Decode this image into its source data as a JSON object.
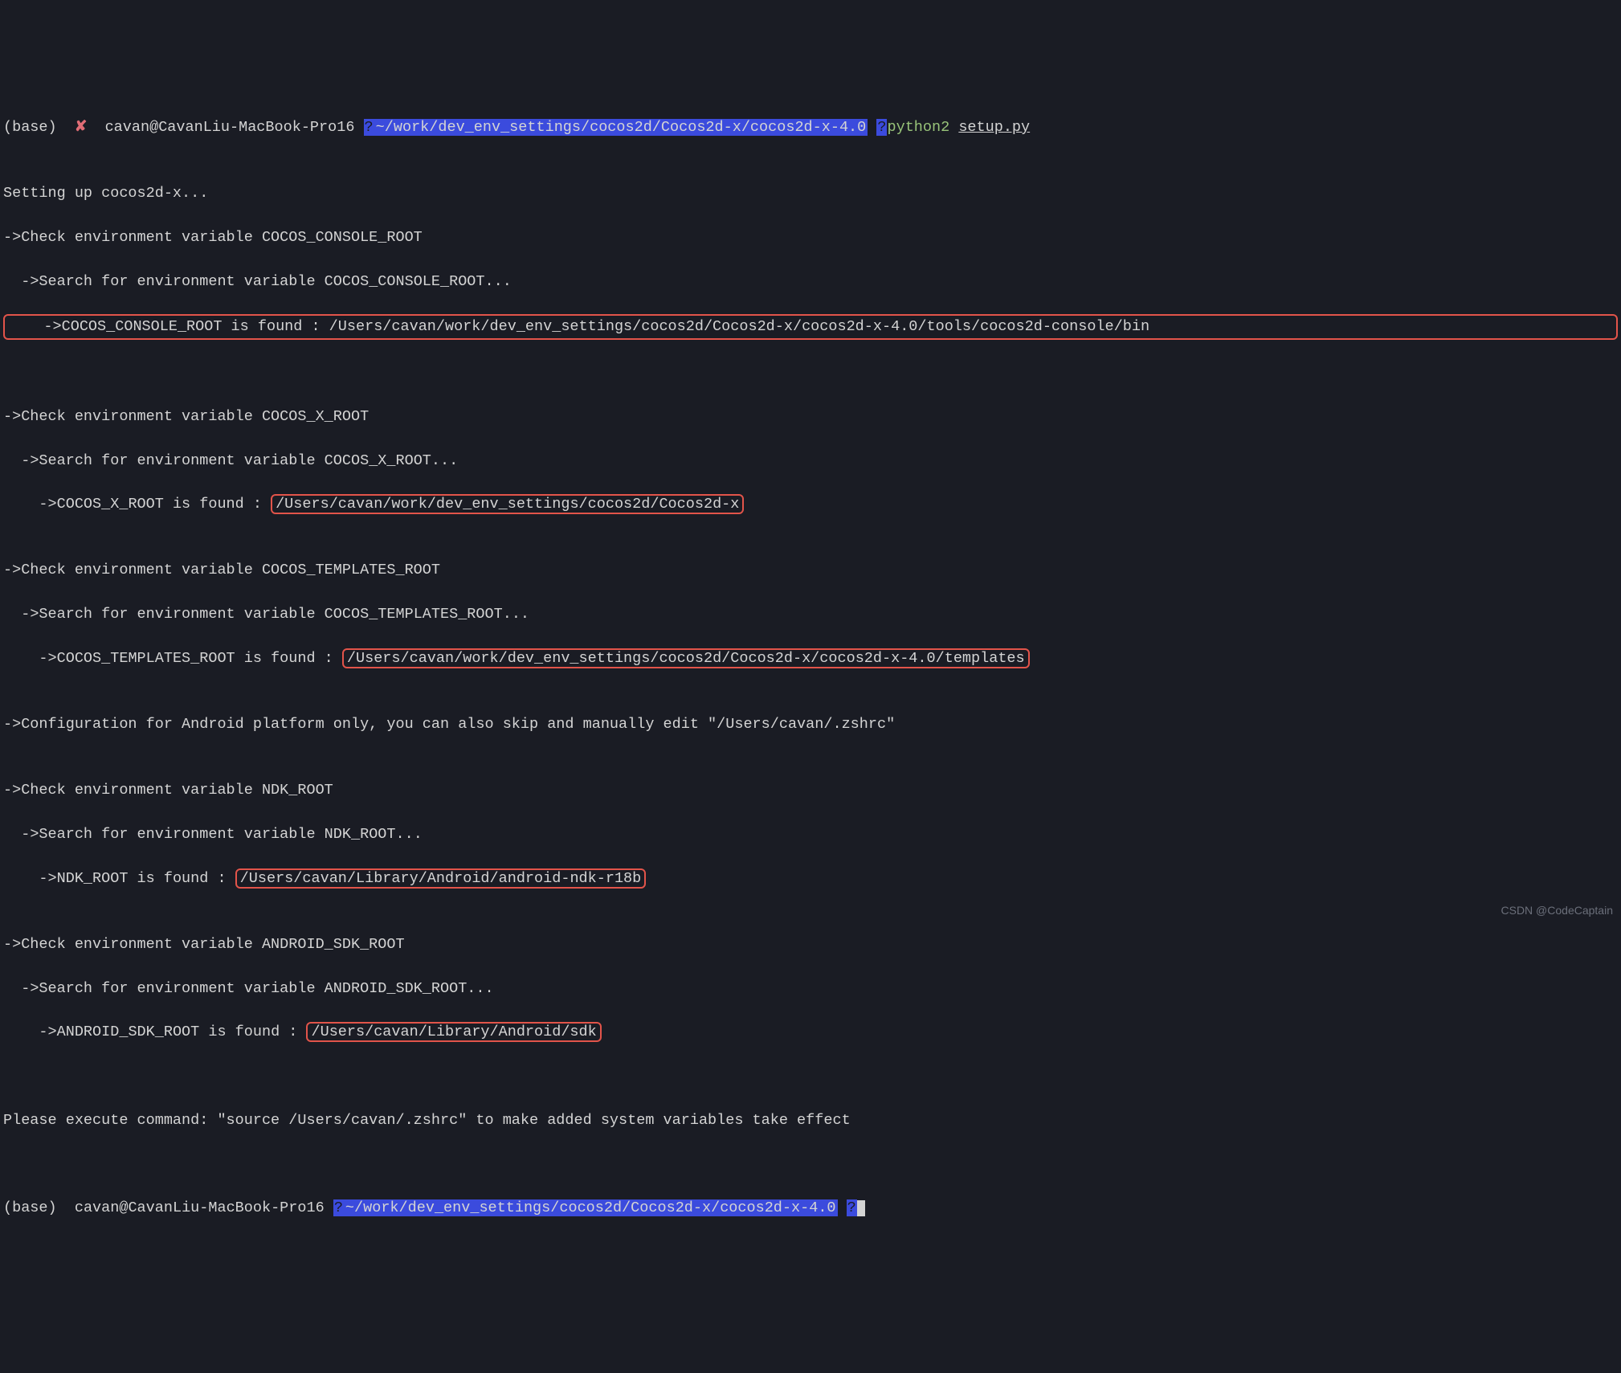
{
  "prompt1": {
    "base": "(base)",
    "x": "✘",
    "user": "cavan@CavanLiu-MacBook-Pro16",
    "q1": "?",
    "path": "~/work/dev_env_settings/cocos2d/Cocos2d-x/cocos2d-x-4.0",
    "q2": "?",
    "python": "python2",
    "cmd": "setup.py"
  },
  "output": {
    "l_blank0": "",
    "l_setup": "Setting up cocos2d-x...",
    "l_ccr_check": "->Check environment variable COCOS_CONSOLE_ROOT",
    "l_ccr_search": "  ->Search for environment variable COCOS_CONSOLE_ROOT...",
    "l_ccr_found_pre": "    ->COCOS_CONSOLE_ROOT is found : /Users/cavan/work/dev_env_settings/cocos2d/Cocos2d-x/cocos2d-x-4.0/tools/cocos2d-console/bin",
    "l_blank1": "",
    "l_blank1b": "",
    "l_cxr_check": "->Check environment variable COCOS_X_ROOT",
    "l_cxr_search": "  ->Search for environment variable COCOS_X_ROOT...",
    "l_cxr_found_pre": "    ->COCOS_X_ROOT is found : ",
    "l_cxr_found_val": "/Users/cavan/work/dev_env_settings/cocos2d/Cocos2d-x",
    "l_blank2": "",
    "l_ctr_check": "->Check environment variable COCOS_TEMPLATES_ROOT",
    "l_ctr_search": "  ->Search for environment variable COCOS_TEMPLATES_ROOT...",
    "l_ctr_found_pre": "    ->COCOS_TEMPLATES_ROOT is found : ",
    "l_ctr_found_val": "/Users/cavan/work/dev_env_settings/cocos2d/Cocos2d-x/cocos2d-x-4.0/templates",
    "l_blank3": "",
    "l_android_cfg": "->Configuration for Android platform only, you can also skip and manually edit \"/Users/cavan/.zshrc\"",
    "l_blank4": "",
    "l_ndk_check": "->Check environment variable NDK_ROOT",
    "l_ndk_search": "  ->Search for environment variable NDK_ROOT...",
    "l_ndk_found_pre": "    ->NDK_ROOT is found : ",
    "l_ndk_found_val": "/Users/cavan/Library/Android/android-ndk-r18b",
    "l_blank5": "",
    "l_asdk_check": "->Check environment variable ANDROID_SDK_ROOT",
    "l_asdk_search": "  ->Search for environment variable ANDROID_SDK_ROOT...",
    "l_asdk_found_pre": "    ->ANDROID_SDK_ROOT is found : ",
    "l_asdk_found_val": "/Users/cavan/Library/Android/sdk",
    "l_blank6": "",
    "l_blank7": "",
    "l_please": "Please execute command: \"source /Users/cavan/.zshrc\" to make added system variables take effect",
    "l_blank8": ""
  },
  "prompt2": {
    "base": "(base)",
    "user": "cavan@CavanLiu-MacBook-Pro16",
    "q1": "?",
    "path": "~/work/dev_env_settings/cocos2d/Cocos2d-x/cocos2d-x-4.0",
    "q2": "?"
  },
  "watermark": "CSDN @CodeCaptain"
}
